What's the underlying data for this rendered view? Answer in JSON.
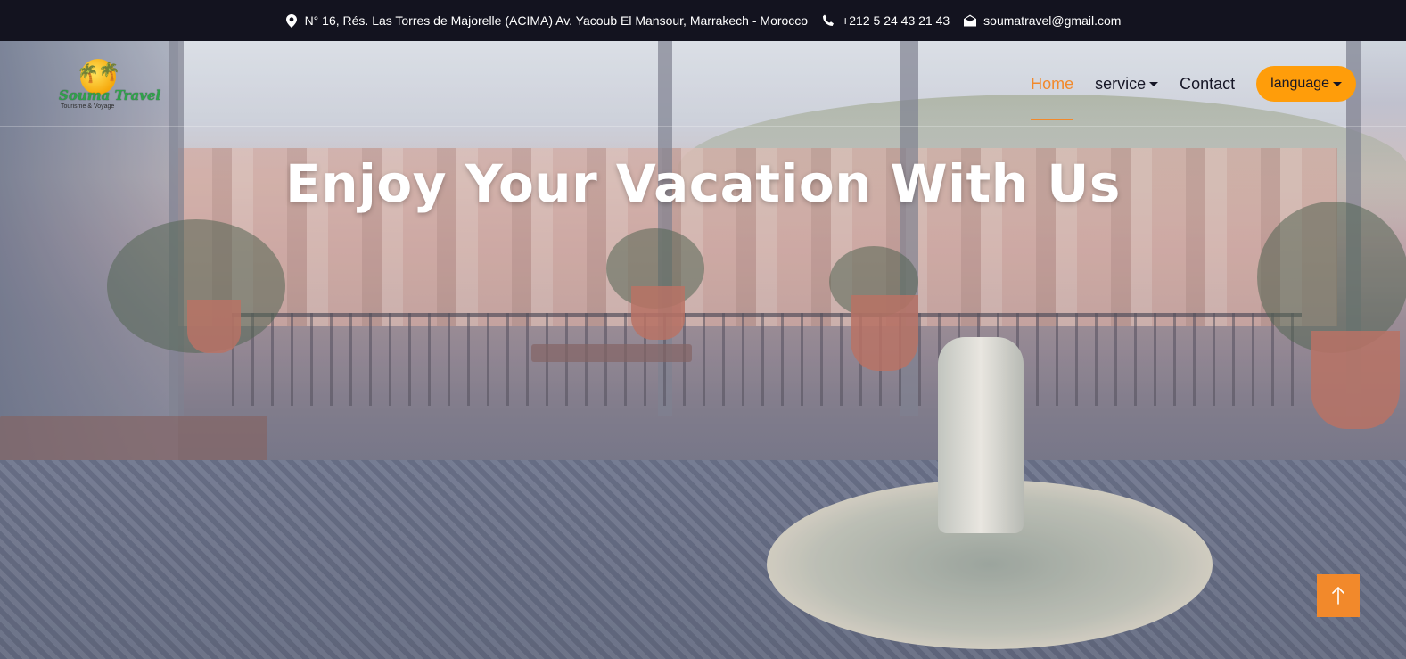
{
  "topbar": {
    "address": "N° 16, Rés. Las Torres de Majorelle (ACIMA) Av. Yacoub El Mansour, Marrakech - Morocco",
    "phone": "+212 5 24 43 21 43",
    "email": "soumatravel@gmail.com",
    "icons": [
      "map-pin-icon",
      "phone-icon",
      "envelope-open-icon"
    ]
  },
  "logo": {
    "brand": "Souma Travel",
    "tagline": "Tourisme & Voyage"
  },
  "nav": {
    "items": [
      {
        "label": "Home",
        "active": true
      },
      {
        "label": "service",
        "dropdown": true
      },
      {
        "label": "Contact"
      }
    ],
    "language_label": "language"
  },
  "hero": {
    "headline": "Enjoy Your Vacation With Us"
  },
  "scroll_top": {
    "icon": "arrow-up-icon"
  },
  "colors": {
    "accent": "#f2892b",
    "language_button": "#ff9d0a",
    "topbar_bg": "#13131f",
    "nav_text": "#161626"
  }
}
